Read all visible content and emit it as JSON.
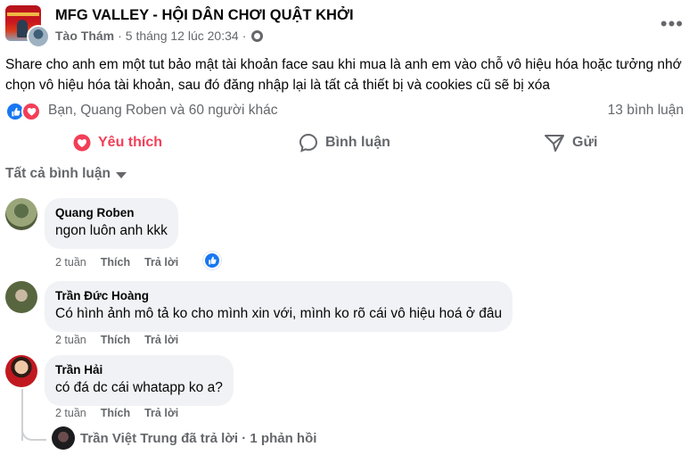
{
  "post": {
    "group_name": "MFG VALLEY - HỘI DÂN CHƠI QUẬT KHỞI",
    "author": "Tào Thám",
    "separator": "·",
    "timestamp": "5 tháng 12 lúc 20:34",
    "separator2": "·",
    "privacy_icon": "globe-icon",
    "more_icon": "more-options-icon",
    "text": "Share cho anh em một tut bảo mật tài khoản face sau khi mua là anh em vào chỗ vô hiệu hóa hoặc tưởng nhớ chọn vô hiệu hóa tài khoản, sau đó đăng nhập lại là tất cả thiết bị và cookies cũ sẽ bị xóa"
  },
  "reactions": {
    "icons": [
      "like-icon",
      "love-icon"
    ],
    "summary": "Bạn, Quang Roben và 60 người khác",
    "comment_count": "13 bình luận"
  },
  "actions": {
    "like_label": "Yêu thích",
    "comment_label": "Bình luận",
    "share_label": "Gửi"
  },
  "sort_label": "Tất cả bình luận",
  "comments": [
    {
      "name": "Quang Roben",
      "text": "ngon luôn anh kkk",
      "age": "2 tuần",
      "like": "Thích",
      "reply": "Trả lời",
      "reaction": "like-icon"
    },
    {
      "name": "Trần Đức Hoàng",
      "text": "Có hình ảnh mô tả ko cho mình xin với, mình ko rõ cái vô hiệu hoá ở đâu",
      "age": "2 tuần",
      "like": "Thích",
      "reply": "Trả lời"
    },
    {
      "name": "Trần Hải",
      "text": "có đá dc cái whatapp ko a?",
      "age": "2 tuần",
      "like": "Thích",
      "reply": "Trả lời"
    }
  ],
  "reply_summary": {
    "text": "Trần Việt Trung đã trả lời · 1 phản hồi"
  },
  "colors": {
    "accent": "#1877f2",
    "love": "#f33e58",
    "secondary_text": "#65676b",
    "bubble": "#f0f2f5"
  }
}
